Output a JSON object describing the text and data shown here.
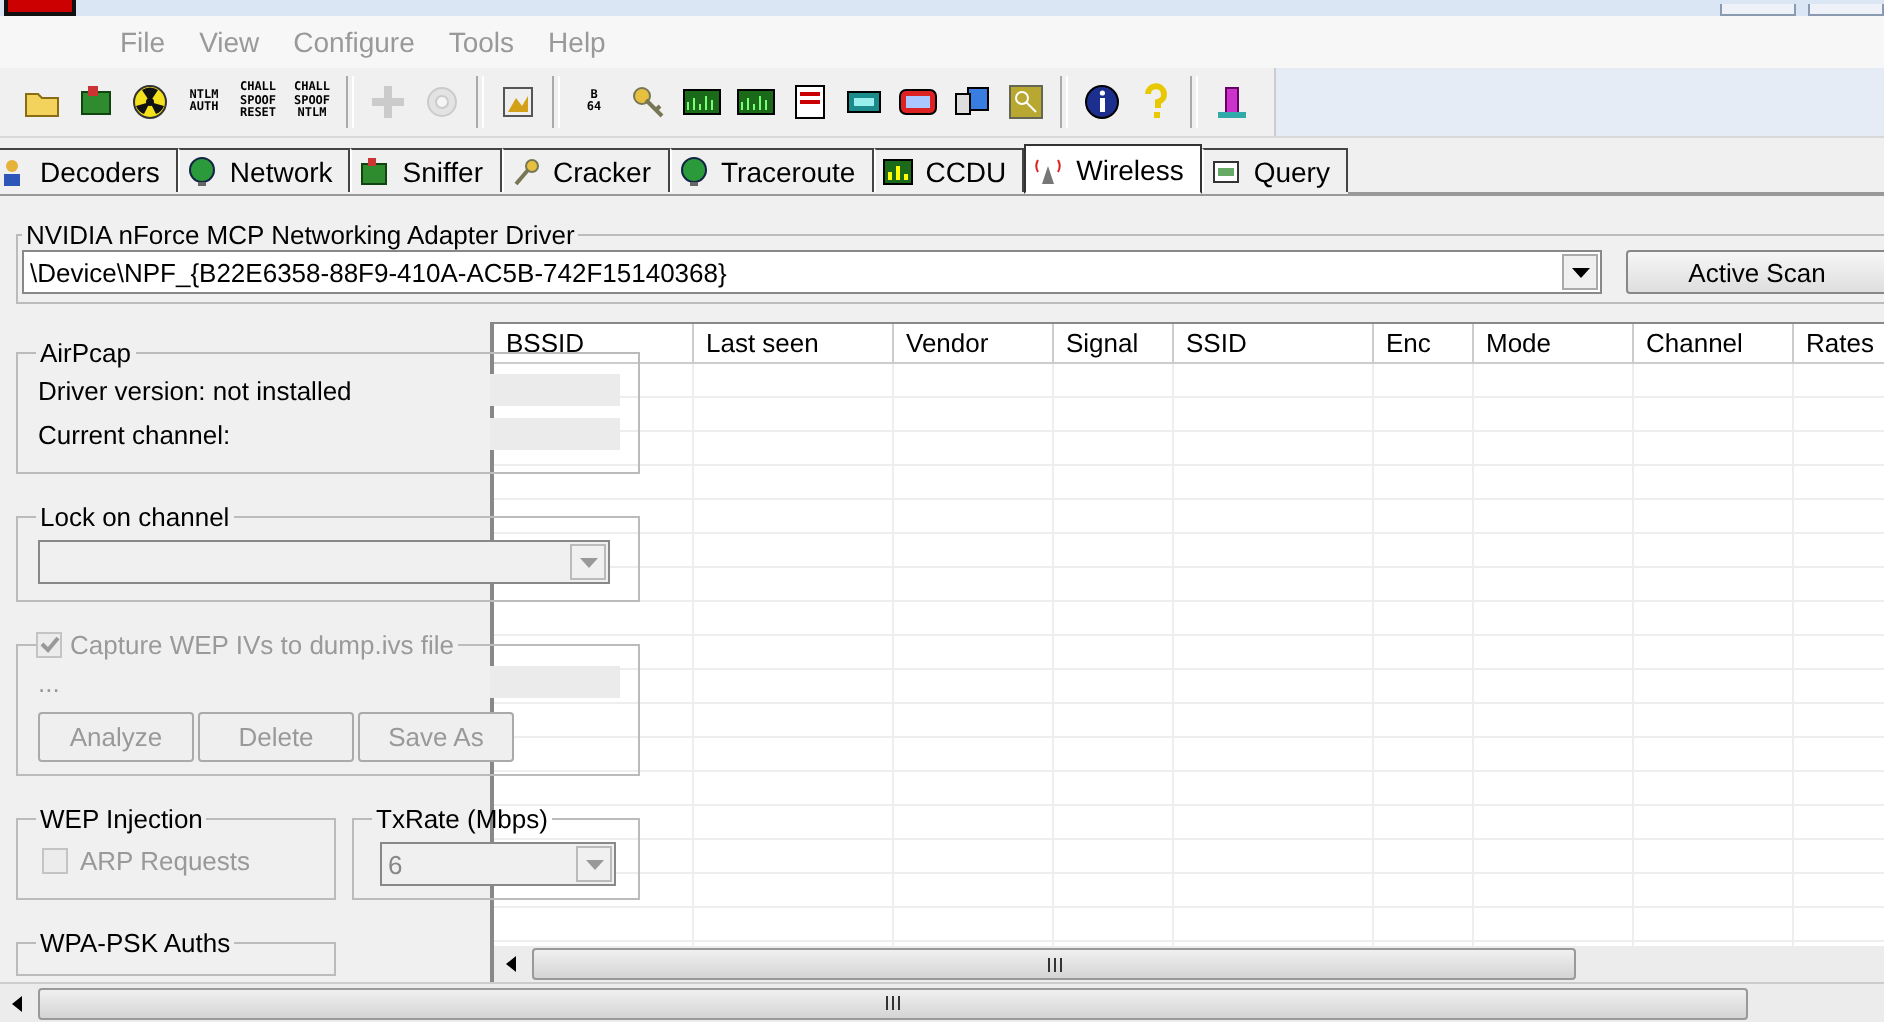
{
  "menu": [
    "File",
    "View",
    "Configure",
    "Tools",
    "Help"
  ],
  "toolbar": [
    {
      "kind": "icon",
      "disabled": false
    },
    {
      "kind": "icon",
      "disabled": false
    },
    {
      "kind": "icon",
      "disabled": false
    },
    {
      "kind": "text",
      "lines": [
        "NTLM",
        "AUTH"
      ],
      "disabled": false
    },
    {
      "kind": "text",
      "lines": [
        "CHALL",
        "SPOOF",
        "RESET"
      ],
      "disabled": false
    },
    {
      "kind": "text",
      "lines": [
        "CHALL",
        "SPOOF",
        "NTLM"
      ],
      "disabled": false
    },
    {
      "kind": "separator"
    },
    {
      "kind": "icon",
      "disabled": true
    },
    {
      "kind": "icon",
      "disabled": true
    },
    {
      "kind": "separator"
    },
    {
      "kind": "icon",
      "disabled": false
    },
    {
      "kind": "separator"
    },
    {
      "kind": "text",
      "lines": [
        "B",
        "64"
      ],
      "disabled": false
    },
    {
      "kind": "icon",
      "disabled": false
    },
    {
      "kind": "icon",
      "disabled": false
    },
    {
      "kind": "icon",
      "disabled": false
    },
    {
      "kind": "icon",
      "disabled": false
    },
    {
      "kind": "icon",
      "disabled": false
    },
    {
      "kind": "icon",
      "disabled": false
    },
    {
      "kind": "icon",
      "disabled": false
    },
    {
      "kind": "icon",
      "disabled": false
    },
    {
      "kind": "separator"
    },
    {
      "kind": "icon",
      "disabled": false
    },
    {
      "kind": "icon",
      "disabled": false
    },
    {
      "kind": "separator"
    },
    {
      "kind": "icon",
      "disabled": false
    }
  ],
  "tabs": [
    {
      "label": "Decoders",
      "selected": false
    },
    {
      "label": "Network",
      "selected": false
    },
    {
      "label": "Sniffer",
      "selected": false
    },
    {
      "label": "Cracker",
      "selected": false
    },
    {
      "label": "Traceroute",
      "selected": false
    },
    {
      "label": "CCDU",
      "selected": false
    },
    {
      "label": "Wireless",
      "selected": true
    },
    {
      "label": "Query",
      "selected": false
    }
  ],
  "adapter": {
    "title": "NVIDIA nForce MCP Networking Adapter Driver",
    "device": "\\Device\\NPF_{B22E6358-88F9-410A-AC5B-742F15140368}",
    "scan_button": "Active Scan"
  },
  "airpcap": {
    "title": "AirPcap",
    "driver_version": "Driver version: not installed",
    "current_channel": "Current channel:"
  },
  "lock_channel": {
    "title": "Lock on channel",
    "disabled": true
  },
  "capture": {
    "label": "Capture WEP IVs to dump.ivs file",
    "checked": true,
    "disabled": true,
    "path": "...",
    "buttons": [
      "Analyze",
      "Delete",
      "Save As"
    ]
  },
  "wep_injection": {
    "title": "WEP Injection",
    "option": {
      "label": "ARP Requests",
      "checked": false,
      "disabled": true
    }
  },
  "txrate": {
    "title": "TxRate (Mbps)",
    "value": "6",
    "disabled": true
  },
  "wpa": {
    "title": "WPA-PSK Auths"
  },
  "table": {
    "columns": [
      "BSSID",
      "Last seen",
      "Vendor",
      "Signal",
      "SSID",
      "Enc",
      "Mode",
      "Channel",
      "Rates"
    ]
  }
}
